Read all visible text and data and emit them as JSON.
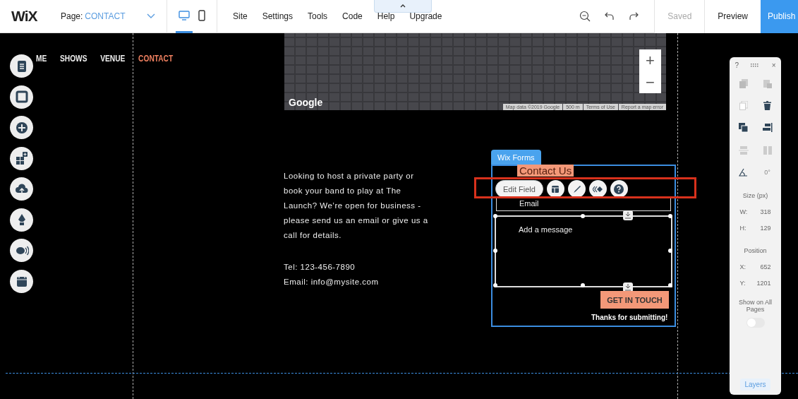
{
  "topbar": {
    "logo": "WiX",
    "page_label": "Page:",
    "page_name": "CONTACT",
    "devices": [
      {
        "kind": "desktop",
        "selected": true
      },
      {
        "kind": "mobile",
        "selected": false
      }
    ],
    "menu": [
      "Site",
      "Settings",
      "Tools",
      "Code",
      "Help",
      "Upgrade"
    ],
    "actions": [
      {
        "label": "Saved",
        "disabled": true
      },
      {
        "label": "Preview",
        "disabled": false
      }
    ],
    "publish": "Publish"
  },
  "site_nav": [
    {
      "label": "ME",
      "selected": false
    },
    {
      "label": "SHOWS",
      "selected": false
    },
    {
      "label": "VENUE",
      "selected": false
    },
    {
      "label": "CONTACT",
      "selected": true
    }
  ],
  "map": {
    "zoom": [
      "+",
      "−"
    ],
    "logo": "Google",
    "attribution": [
      "Map data ©2019 Google",
      "500 m",
      "Terms of Use",
      "Report a map error"
    ]
  },
  "contact": {
    "text": "Looking to host a private party or book your band to play at The Launch? We’re open for business - please send us an email or give us a call for details.",
    "tel": "Tel: 123-456-7890",
    "email": "Email: info@mysite.com"
  },
  "form": {
    "tab": "Wix Forms",
    "title": "Contact Us",
    "edit_button": "Edit Field",
    "email_label": "Email",
    "message_placeholder": "Add a message",
    "submit": "GET IN TOUCH",
    "success": "Thanks for submitting!"
  },
  "panel": {
    "help": "?",
    "close": "×",
    "angle": "0°",
    "size_title": "Size (px)",
    "fields": [
      {
        "label": "W:",
        "value": "318"
      },
      {
        "label": "H:",
        "value": "129"
      }
    ],
    "position_title": "Position",
    "position": [
      {
        "label": "X:",
        "value": "652"
      },
      {
        "label": "Y:",
        "value": "1201"
      }
    ],
    "show_all_label": "Show on All Pages",
    "show_all_on": false,
    "layers": "Layers"
  }
}
